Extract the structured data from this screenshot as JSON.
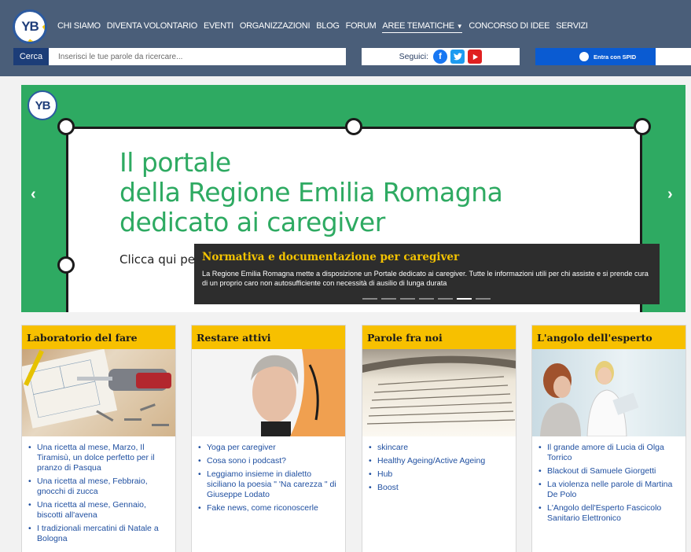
{
  "header": {
    "logo_text": "YB",
    "nav": [
      {
        "label": "CHI SIAMO"
      },
      {
        "label": "DIVENTA VOLONTARIO"
      },
      {
        "label": "EVENTI"
      },
      {
        "label": "ORGANIZZAZIONI"
      },
      {
        "label": "BLOG"
      },
      {
        "label": "FORUM"
      },
      {
        "label": "AREE TEMATICHE",
        "has_caret": true
      },
      {
        "label": "CONCORSO DI IDEE"
      },
      {
        "label": "SERVIZI"
      }
    ],
    "search": {
      "button_label": "Cerca",
      "placeholder": "Inserisci le tue parole da ricercare..."
    },
    "social": {
      "label": "Seguici:",
      "icons": [
        "facebook-icon",
        "twitter-icon",
        "youtube-icon"
      ]
    },
    "spid": {
      "label": "Entra con SPID"
    }
  },
  "hero": {
    "logo_text": "YB",
    "headline_lines": [
      "Il portale",
      "della Regione Emilia Romagna",
      "dedicato ai caregiver"
    ],
    "cta_text": "Clicca qui per",
    "prev_arrow": "‹",
    "next_arrow": "›",
    "caption": {
      "title": "Normativa e documentazione per caregiver",
      "text": "La Regione Emilia Romagna mette a disposizione un Portale dedicato ai caregiver. Tutte le informazioni utili per chi assiste e si prende cura di un proprio caro non autosufficiente con necessità di ausilio di lunga durata"
    },
    "slides_total": 7,
    "active_slide": 6
  },
  "cards": [
    {
      "title": "Laboratorio del fare",
      "items": [
        "Una ricetta al mese, Marzo, Il Tiramisù, un dolce perfetto per il pranzo di Pasqua",
        "Una ricetta al mese, Febbraio, gnocchi di zucca",
        "Una ricetta al mese, Gennaio, biscotti all'avena",
        "I tradizionali mercatini di Natale a Bologna"
      ]
    },
    {
      "title": "Restare attivi",
      "items": [
        "Yoga per caregiver",
        "Cosa sono i podcast?",
        "Leggiamo insieme in dialetto siciliano la poesia \" 'Na carezza \" di Giuseppe Lodato",
        "Fake news, come riconoscerle"
      ]
    },
    {
      "title": "Parole fra noi",
      "items": [
        "skincare",
        "Healthy Ageing/Active Ageing",
        "Hub",
        "Boost"
      ]
    },
    {
      "title": "L'angolo dell'esperto",
      "items": [
        "Il grande amore di Lucia di Olga Torrico",
        "Blackout di Samuele Giorgetti",
        "La violenza nelle parole di Martina De Polo",
        "L'Angolo dell'Esperto Fascicolo Sanitario Elettronico"
      ]
    }
  ]
}
